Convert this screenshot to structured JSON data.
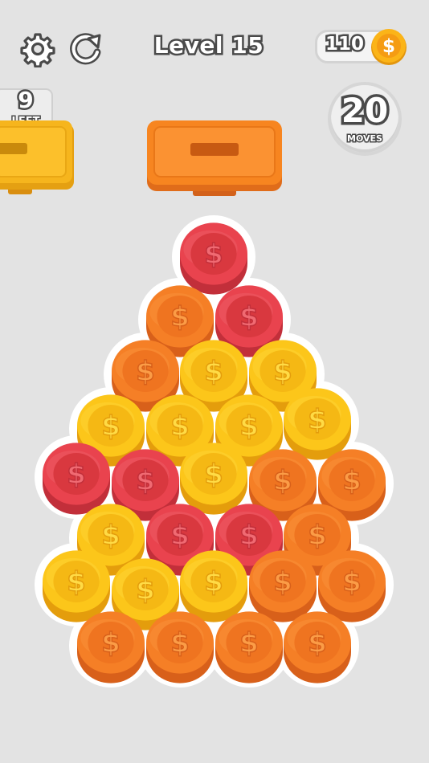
{
  "header": {
    "settings_icon": "gear-icon",
    "restart_icon": "restart-icon",
    "level_title": "Level 15",
    "coin_balance": "110",
    "coin_icon": "dollar-coin-icon"
  },
  "status": {
    "left_count": "9",
    "left_label": "LEFT",
    "moves_count": "20",
    "moves_label": "MOVES"
  },
  "trays": [
    {
      "name": "tray-left",
      "color": "#f6b51d",
      "partially_visible": true
    },
    {
      "name": "tray-center",
      "color": "#f78520"
    }
  ],
  "colors": {
    "background": "#e3e3e3",
    "red": "#e9434e",
    "orange": "#f57f26",
    "yellow": "#fcc61a"
  },
  "board": {
    "rows": [
      [
        "red"
      ],
      [
        "orange",
        "red"
      ],
      [
        "orange",
        "yellow",
        "yellow"
      ],
      [
        "yellow",
        "yellow",
        "yellow",
        "yellow"
      ],
      [
        "red",
        "red",
        "yellow",
        "orange",
        "orange"
      ],
      [
        "yellow",
        "red",
        "red",
        "orange"
      ],
      [
        "yellow",
        "yellow",
        "yellow",
        "orange",
        "orange"
      ],
      [
        "orange",
        "orange",
        "orange",
        "orange"
      ]
    ]
  }
}
